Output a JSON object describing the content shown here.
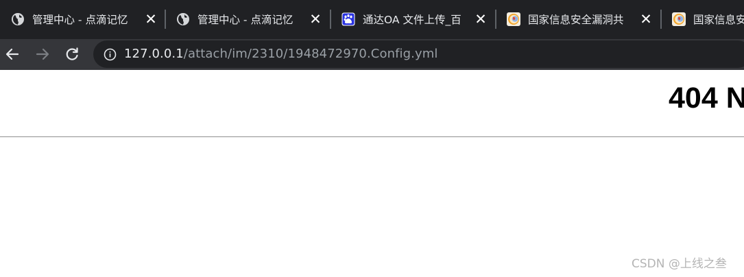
{
  "tabs": [
    {
      "title": "管理中心 - 点滴记忆",
      "favicon": "globe-icon",
      "close": "✕"
    },
    {
      "title": "管理中心 - 点滴记忆",
      "favicon": "globe-icon",
      "close": "✕"
    },
    {
      "title": "通达OA 文件上传_百",
      "favicon": "baidu-paw-icon",
      "close": "✕"
    },
    {
      "title": "国家信息安全漏洞共",
      "favicon": "cnvd-globe-icon",
      "close": "✕"
    },
    {
      "title": "国家信息安",
      "favicon": "cnvd-globe-icon"
    }
  ],
  "toolbar": {
    "back_icon": "arrow-left-icon",
    "forward_icon": "arrow-right-icon",
    "reload_icon": "reload-icon",
    "info_icon": "info-circle-icon",
    "url_host": "127.0.0.1",
    "url_path": "/attach/im/2310/1948472970.Config.yml"
  },
  "page": {
    "heading": "404 N",
    "watermark": "CSDN @上线之叁"
  },
  "colors": {
    "tabstrip_bg": "#202124",
    "toolbar_bg": "#35363a",
    "omnibox_bg": "#202124",
    "url_host": "#e8eaed",
    "url_path": "#9aa0a6",
    "page_bg": "#ffffff",
    "rule": "#8f8f8f"
  }
}
